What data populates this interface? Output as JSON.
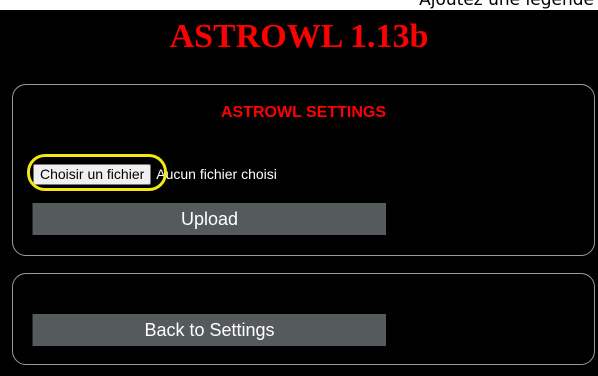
{
  "top_strip_text": "Ajoutez une légende",
  "app_title": "ASTROWL 1.13b",
  "settings_panel": {
    "heading": "ASTROWL SETTINGS",
    "file_input": {
      "button_label": "Choisir un fichier",
      "status": "Aucun fichier choisi"
    },
    "upload_label": "Upload"
  },
  "back_panel": {
    "back_label": "Back to Settings"
  },
  "colors": {
    "background": "#000000",
    "title": "#ff0000",
    "button": "#555a5c",
    "panel_border": "#9a9a9a",
    "highlight": "#f5e615"
  }
}
